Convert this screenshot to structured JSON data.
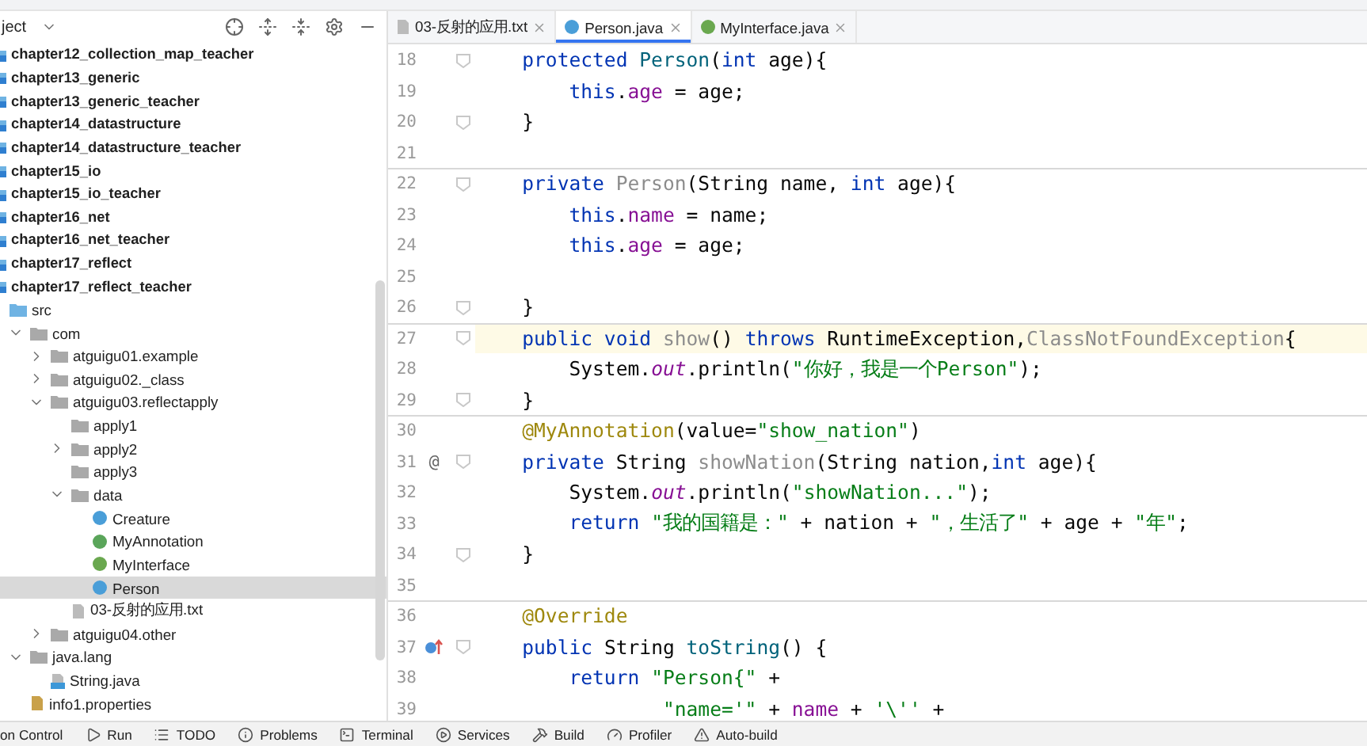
{
  "project_panel": {
    "title": "ject",
    "items": [
      {
        "name": "chapter12_collection_map_teacher",
        "kind": "module",
        "selected": false
      },
      {
        "name": "chapter13_generic",
        "kind": "module",
        "selected": false
      },
      {
        "name": "chapter13_generic_teacher",
        "kind": "module",
        "selected": false
      },
      {
        "name": "chapter14_datastructure",
        "kind": "module",
        "selected": false
      },
      {
        "name": "chapter14_datastructure_teacher",
        "kind": "module",
        "selected": false
      },
      {
        "name": "chapter15_io",
        "kind": "module",
        "selected": false
      },
      {
        "name": "chapter15_io_teacher",
        "kind": "module",
        "selected": false
      },
      {
        "name": "chapter16_net",
        "kind": "module",
        "selected": false
      },
      {
        "name": "chapter16_net_teacher",
        "kind": "module",
        "selected": false
      },
      {
        "name": "chapter17_reflect",
        "kind": "module",
        "selected": false
      },
      {
        "name": "chapter17_reflect_teacher",
        "kind": "module",
        "selected": false,
        "children": [
          {
            "name": "src",
            "kind": "source",
            "selected": false,
            "children": [
              {
                "name": "com",
                "kind": "package",
                "expanded": true,
                "selected": false,
                "children": [
                  {
                    "name": "atguigu01.example",
                    "kind": "package",
                    "expanded": false,
                    "selected": false
                  },
                  {
                    "name": "atguigu02._class",
                    "kind": "package",
                    "expanded": false,
                    "selected": false
                  },
                  {
                    "name": "atguigu03.reflectapply",
                    "kind": "package",
                    "expanded": true,
                    "selected": false,
                    "children": [
                      {
                        "name": "apply1",
                        "kind": "package",
                        "selected": false
                      },
                      {
                        "name": "apply2",
                        "kind": "package",
                        "expanded": false,
                        "selected": false
                      },
                      {
                        "name": "apply3",
                        "kind": "package",
                        "selected": false
                      },
                      {
                        "name": "data",
                        "kind": "package",
                        "expanded": true,
                        "selected": false,
                        "children": [
                          {
                            "name": "Creature",
                            "kind": "class",
                            "selected": false
                          },
                          {
                            "name": "MyAnnotation",
                            "kind": "annotation",
                            "selected": false
                          },
                          {
                            "name": "MyInterface",
                            "kind": "interface",
                            "selected": false
                          },
                          {
                            "name": "Person",
                            "kind": "class",
                            "selected": true
                          }
                        ]
                      },
                      {
                        "name": "03-反射的应用.txt",
                        "kind": "text",
                        "selected": false
                      }
                    ]
                  },
                  {
                    "name": "atguigu04.other",
                    "kind": "package",
                    "expanded": false,
                    "selected": false
                  }
                ]
              },
              {
                "name": "java.lang",
                "kind": "package",
                "expanded": true,
                "selected": false,
                "children": [
                  {
                    "name": "String.java",
                    "kind": "java",
                    "selected": false
                  }
                ]
              },
              {
                "name": "info1.properties",
                "kind": "properties",
                "selected": false
              }
            ]
          }
        ]
      }
    ]
  },
  "editor_tabs": [
    {
      "label": "03-反射的应用.txt",
      "kind": "text",
      "selected": false
    },
    {
      "label": "Person.java",
      "kind": "class",
      "selected": true
    },
    {
      "label": "MyInterface.java",
      "kind": "interface",
      "selected": false
    }
  ],
  "code_lines": [
    {
      "number": "18",
      "fold": true,
      "separator_above": false,
      "current": false,
      "tokens": [
        {
          "keyword": "    protected "
        },
        {
          "method": "Person"
        },
        {
          "plain": "("
        },
        {
          "keyword": "int"
        },
        {
          "plain": " age){"
        }
      ]
    },
    {
      "number": "19",
      "fold": false,
      "separator_above": false,
      "current": false,
      "tokens": [
        {
          "keyword": "        this"
        },
        {
          "plain": "."
        },
        {
          "field": "age"
        },
        {
          "plain": " = age;"
        }
      ]
    },
    {
      "number": "20",
      "fold": true,
      "separator_above": false,
      "current": false,
      "tokens": [
        {
          "plain": "    }"
        }
      ]
    },
    {
      "number": "21",
      "fold": false,
      "separator_above": false,
      "current": false
    },
    {
      "number": "22",
      "fold": true,
      "separator_above": true,
      "current": false,
      "tokens": [
        {
          "keyword": "    private "
        },
        {
          "unused": "Person"
        },
        {
          "plain": "(String name, "
        },
        {
          "keyword": "int"
        },
        {
          "plain": " age){"
        }
      ]
    },
    {
      "number": "23",
      "fold": false,
      "separator_above": false,
      "current": false,
      "tokens": [
        {
          "keyword": "        this"
        },
        {
          "plain": "."
        },
        {
          "field": "name"
        },
        {
          "plain": " = name;"
        }
      ]
    },
    {
      "number": "24",
      "fold": false,
      "separator_above": false,
      "current": false,
      "tokens": [
        {
          "keyword": "        this"
        },
        {
          "plain": "."
        },
        {
          "field": "age"
        },
        {
          "plain": " = age;"
        }
      ]
    },
    {
      "number": "25",
      "fold": false,
      "separator_above": false,
      "current": false
    },
    {
      "number": "26",
      "fold": true,
      "separator_above": false,
      "current": false,
      "tokens": [
        {
          "plain": "    }"
        }
      ]
    },
    {
      "number": "27",
      "fold": true,
      "separator_above": true,
      "current": true,
      "tokens": [
        {
          "keyword": "    public void "
        },
        {
          "unused": "show"
        },
        {
          "plain": "() "
        },
        {
          "keyword": "throws"
        },
        {
          "plain": " RuntimeException,"
        },
        {
          "unused": "ClassNotFoundException"
        },
        {
          "plain": "{"
        }
      ]
    },
    {
      "number": "28",
      "fold": false,
      "separator_above": false,
      "current": false,
      "tokens": [
        {
          "plain": "        System."
        },
        {
          "static": "out"
        },
        {
          "plain": ".println("
        },
        {
          "string": "\"你好，我是一个Person\""
        },
        {
          "plain": ");"
        }
      ]
    },
    {
      "number": "29",
      "fold": true,
      "separator_above": false,
      "current": false,
      "tokens": [
        {
          "plain": "    }"
        }
      ]
    },
    {
      "number": "30",
      "fold": false,
      "separator_above": true,
      "current": false,
      "tokens": [
        {
          "annotation": "    @MyAnnotation"
        },
        {
          "plain": "(value="
        },
        {
          "string": "\"show_nation\""
        },
        {
          "plain": ")"
        }
      ]
    },
    {
      "number": "31",
      "fold": true,
      "separator_above": false,
      "current": false,
      "gutter_text": "@",
      "tokens": [
        {
          "keyword": "    private"
        },
        {
          "plain": " String "
        },
        {
          "unused": "showNation"
        },
        {
          "plain": "(String nation,"
        },
        {
          "keyword": "int"
        },
        {
          "plain": " age){"
        }
      ]
    },
    {
      "number": "32",
      "fold": false,
      "separator_above": false,
      "current": false,
      "tokens": [
        {
          "plain": "        System."
        },
        {
          "static": "out"
        },
        {
          "plain": ".println("
        },
        {
          "string": "\"showNation...\""
        },
        {
          "plain": ");"
        }
      ]
    },
    {
      "number": "33",
      "fold": false,
      "separator_above": false,
      "current": false,
      "tokens": [
        {
          "keyword": "        return "
        },
        {
          "string": "\"我的国籍是：\""
        },
        {
          "plain": " + nation + "
        },
        {
          "string": "\"，生活了\""
        },
        {
          "plain": " + age + "
        },
        {
          "string": "\"年\""
        },
        {
          "plain": ";"
        }
      ]
    },
    {
      "number": "34",
      "fold": true,
      "separator_above": false,
      "current": false,
      "tokens": [
        {
          "plain": "    }"
        }
      ]
    },
    {
      "number": "35",
      "fold": false,
      "separator_above": false,
      "current": false
    },
    {
      "number": "36",
      "fold": false,
      "separator_above": true,
      "current": false,
      "tokens": [
        {
          "annotation": "    @Override"
        }
      ]
    },
    {
      "number": "37",
      "fold": true,
      "separator_above": false,
      "current": false,
      "overrides": true,
      "tokens": [
        {
          "keyword": "    public"
        },
        {
          "plain": " String "
        },
        {
          "method": "toString"
        },
        {
          "plain": "() {"
        }
      ]
    },
    {
      "number": "38",
      "fold": false,
      "separator_above": false,
      "current": false,
      "tokens": [
        {
          "keyword": "        return "
        },
        {
          "string": "\"Person{\""
        },
        {
          "plain": " +"
        }
      ]
    },
    {
      "number": "39",
      "fold": false,
      "separator_above": false,
      "current": false,
      "tokens": [
        {
          "string": "                \"name='\""
        },
        {
          "plain": " + "
        },
        {
          "field": "name"
        },
        {
          "plain": " + "
        },
        {
          "string": "'\\''"
        },
        {
          "plain": " +"
        }
      ]
    }
  ],
  "status_bar": [
    {
      "label": "on Control",
      "kind": "none"
    },
    {
      "label": "Run",
      "kind": "run"
    },
    {
      "label": "TODO",
      "kind": "todo"
    },
    {
      "label": "Problems",
      "kind": "problems"
    },
    {
      "label": "Terminal",
      "kind": "terminal"
    },
    {
      "label": "Services",
      "kind": "services"
    },
    {
      "label": "Build",
      "kind": "build"
    },
    {
      "label": "Profiler",
      "kind": "profiler"
    },
    {
      "label": "Auto-build",
      "kind": "autobuild"
    }
  ]
}
